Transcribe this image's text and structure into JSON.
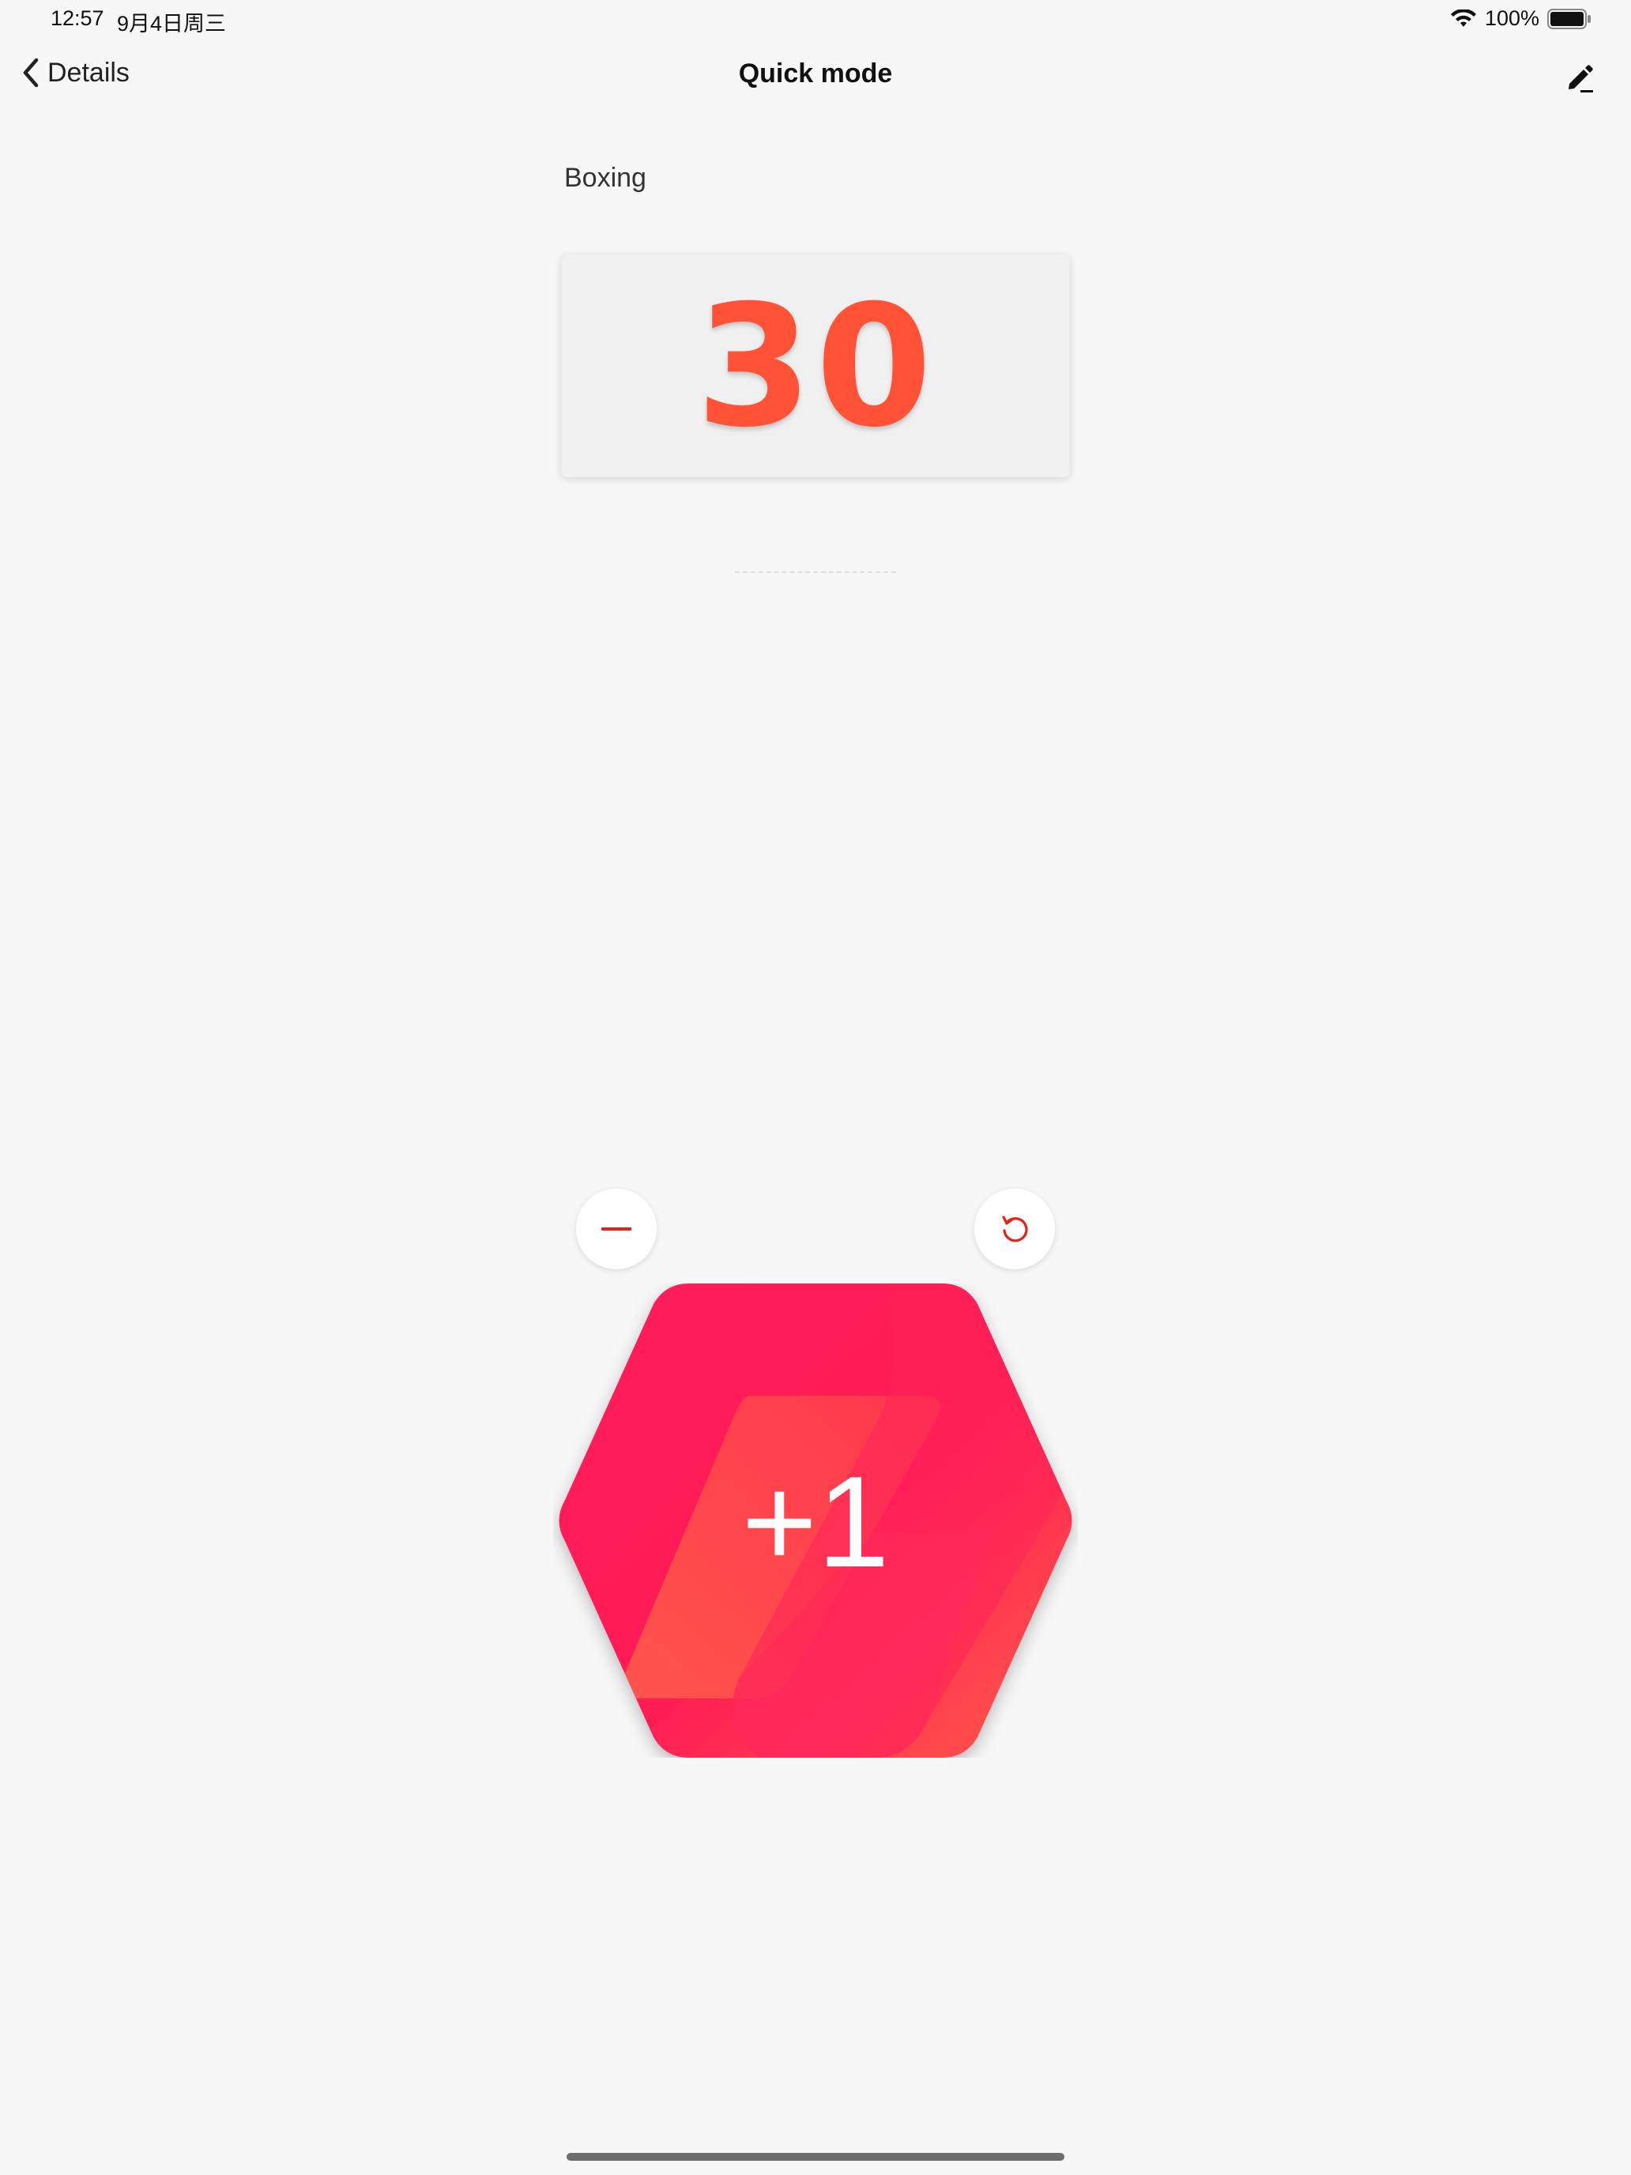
{
  "status_bar": {
    "time": "12:57",
    "date": "9月4日周三",
    "battery": "100%",
    "wifi_icon": "wifi-icon",
    "battery_icon": "battery-full-icon"
  },
  "nav": {
    "back_label": "Details",
    "back_icon": "chevron-left-icon",
    "title": "Quick mode",
    "edit_icon": "pencil-icon"
  },
  "counter": {
    "activity": "Boxing",
    "count": "30",
    "increment_label": "+1",
    "decrement_icon": "minus-icon",
    "reset_icon": "reset-icon"
  },
  "colors": {
    "count_text": "#ff5236",
    "accent_red": "#ff1f4f",
    "accent_orange": "#ff5a4a",
    "icon_red": "#e8201c"
  }
}
